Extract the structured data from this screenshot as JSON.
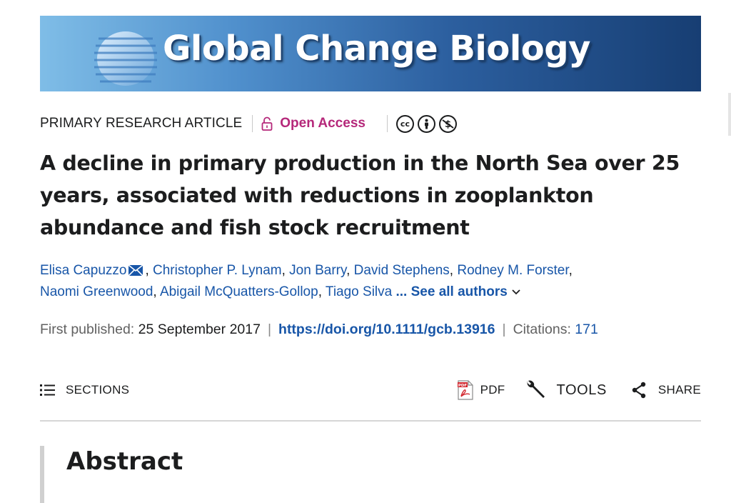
{
  "journal": {
    "title": "Global Change Biology"
  },
  "article": {
    "type": "PRIMARY RESEARCH ARTICLE",
    "access": "Open Access",
    "license_icons": [
      "cc-icon",
      "by-attribution-icon",
      "non-commercial-icon"
    ],
    "title": "A decline in primary production in the North Sea over 25 years, associated with reductions in zooplankton abundance and fish stock recruitment",
    "authors_line1": [
      {
        "name": "Elisa Capuzzo",
        "corresponding": true,
        "sep": ", "
      },
      {
        "name": "Christopher P. Lynam",
        "sep": ", "
      },
      {
        "name": "Jon Barry",
        "sep": ", "
      },
      {
        "name": "David Stephens",
        "sep": ", "
      },
      {
        "name": "Rodney M. Forster",
        "sep": ","
      }
    ],
    "authors_line2": [
      {
        "name": "Naomi Greenwood",
        "sep": ", "
      },
      {
        "name": "Abigail McQuatters-Gollop",
        "sep": ", "
      },
      {
        "name": "Tiago Silva",
        "sep": " "
      }
    ],
    "see_all_label": "... See all authors",
    "first_published_label": "First published:",
    "first_published_date": "25 September 2017",
    "doi": "https://doi.org/10.1111/gcb.13916",
    "citations_label": "Citations:",
    "citations_count": "171"
  },
  "toolbar": {
    "sections_label": "SECTIONS",
    "pdf_label": "PDF",
    "tools_label": "TOOLS",
    "share_label": "SHARE"
  },
  "abstract": {
    "heading": "Abstract"
  },
  "colors": {
    "link_blue": "#1856a8",
    "open_access_magenta": "#b5287a",
    "banner_light": "#7fbde7",
    "banner_dark": "#173e73"
  }
}
